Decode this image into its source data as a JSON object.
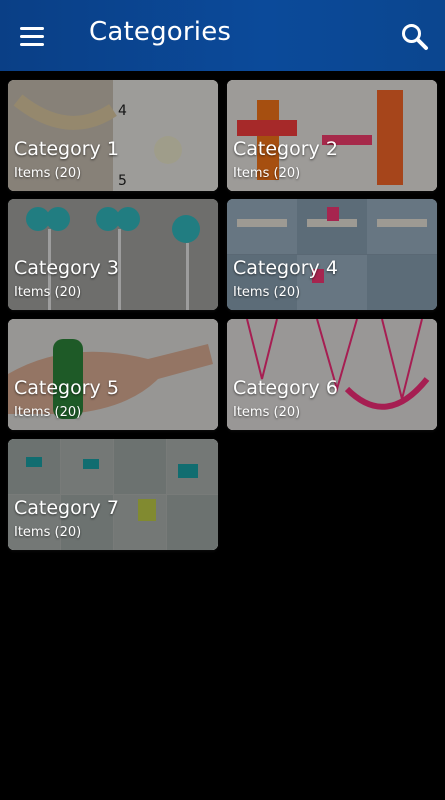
{
  "appbar": {
    "title": "Categories",
    "menu_icon": "hamburger-menu-icon",
    "search_icon": "search-icon"
  },
  "categories": [
    {
      "name": "Category 1",
      "count": "Items (20)"
    },
    {
      "name": "Category 2",
      "count": "Items (20)"
    },
    {
      "name": "Category 3",
      "count": "Items (20)"
    },
    {
      "name": "Category 4",
      "count": "Items (20)"
    },
    {
      "name": "Category 5",
      "count": "Items (20)"
    },
    {
      "name": "Category 6",
      "count": "Items (20)"
    },
    {
      "name": "Category 7",
      "count": "Items (20)"
    }
  ],
  "colors": {
    "appbar": "#0b4a9a",
    "background": "#000000",
    "text": "#ffffff"
  }
}
